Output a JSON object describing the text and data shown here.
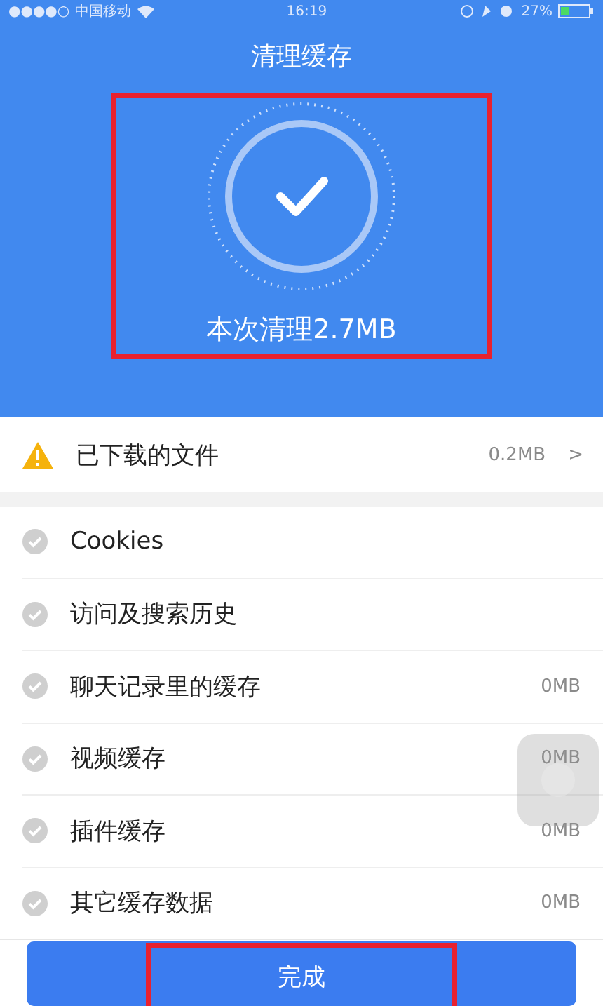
{
  "status_bar": {
    "signal": "●●●●○",
    "carrier": "中国移动",
    "time": "16:19",
    "battery": "27%"
  },
  "header": {
    "title": "清理缓存"
  },
  "result": {
    "text": "本次清理2.7MB"
  },
  "warning_row": {
    "label": "已下载的文件",
    "size": "0.2MB",
    "chevron": ">"
  },
  "items": [
    {
      "label": "Cookies"
    },
    {
      "label": "访问及搜索历史"
    },
    {
      "label": "聊天记录里的缓存",
      "size": "0MB"
    },
    {
      "label": "视频缓存",
      "size": "0MB"
    },
    {
      "label": "插件缓存",
      "size": "0MB"
    },
    {
      "label": "其它缓存数据",
      "size": "0MB"
    }
  ],
  "done_button": {
    "label": "完成"
  }
}
